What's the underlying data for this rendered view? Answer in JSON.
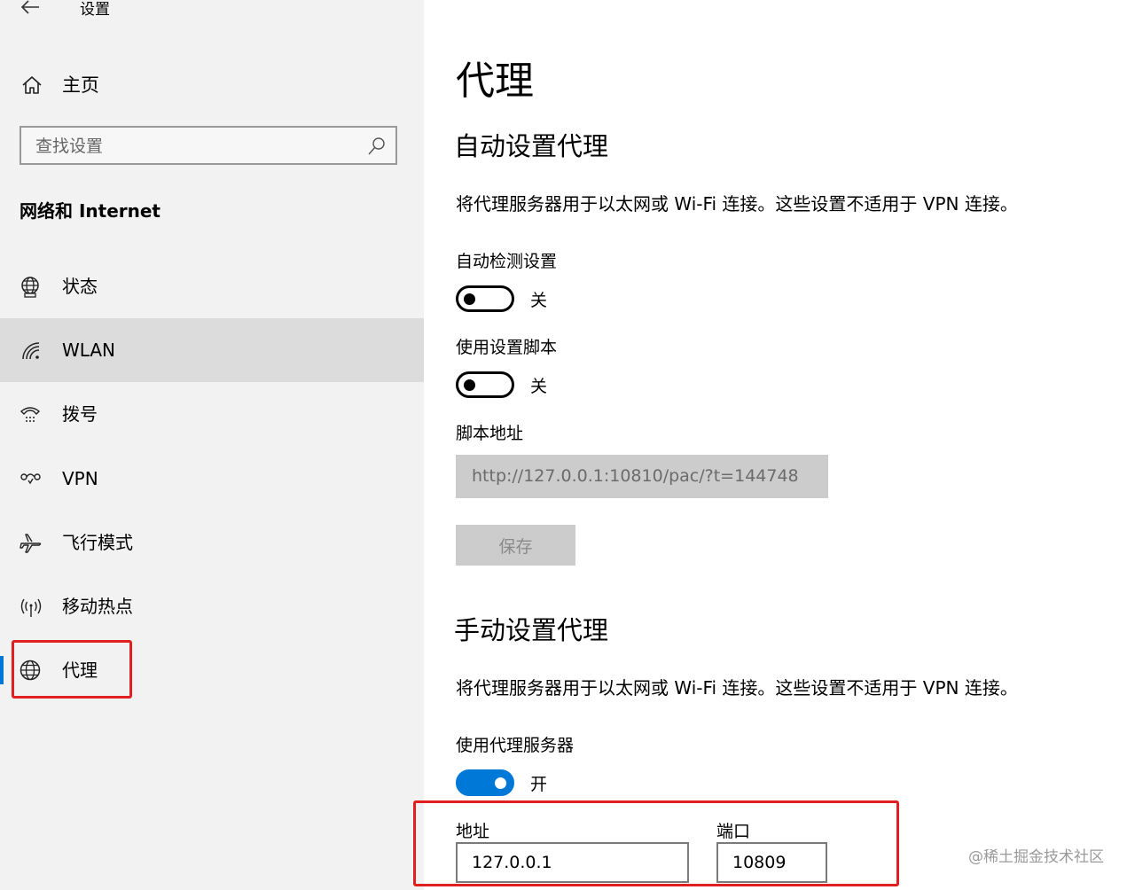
{
  "window": {
    "title": "设置"
  },
  "sidebar": {
    "home_label": "主页",
    "search_placeholder": "查找设置",
    "section_title": "网络和 Internet",
    "items": [
      {
        "label": "状态",
        "icon": "globe-status-icon"
      },
      {
        "label": "WLAN",
        "icon": "wifi-icon"
      },
      {
        "label": "拨号",
        "icon": "dialup-icon"
      },
      {
        "label": "VPN",
        "icon": "vpn-icon"
      },
      {
        "label": "飞行模式",
        "icon": "airplane-icon"
      },
      {
        "label": "移动热点",
        "icon": "hotspot-icon"
      },
      {
        "label": "代理",
        "icon": "globe-icon"
      }
    ],
    "hovered_item": "WLAN",
    "selected_item": "代理"
  },
  "main": {
    "title": "代理",
    "auto": {
      "heading": "自动设置代理",
      "description": "将代理服务器用于以太网或 Wi-Fi 连接。这些设置不适用于 VPN 连接。",
      "detect_label": "自动检测设置",
      "detect_state": "关",
      "script_label": "使用设置脚本",
      "script_state": "关",
      "address_label": "脚本地址",
      "address_value": "http://127.0.0.1:10810/pac/?t=144748",
      "save_label": "保存"
    },
    "manual": {
      "heading": "手动设置代理",
      "description": "将代理服务器用于以太网或 Wi-Fi 连接。这些设置不适用于 VPN 连接。",
      "use_proxy_label": "使用代理服务器",
      "use_proxy_state": "开",
      "address_label": "地址",
      "address_value": "127.0.0.1",
      "port_label": "端口",
      "port_value": "10809"
    }
  },
  "watermark": "@稀土掘金技术社区",
  "colors": {
    "accent": "#0078d7",
    "highlight": "#e02020",
    "sidebar_bg": "#f2f2f2",
    "hover_bg": "#dcdcdc"
  }
}
